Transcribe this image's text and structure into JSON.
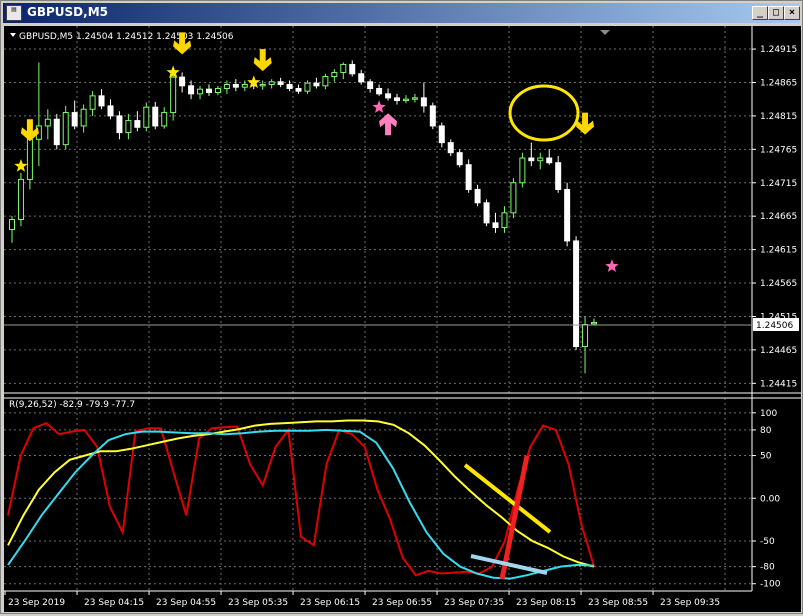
{
  "window": {
    "title": "GBPUSD,M5",
    "icon_name": "chart-window-icon",
    "buttons": {
      "minimize": "_",
      "maximize": "□",
      "close": "×"
    }
  },
  "chart_header": "GBPUSD,M5  1.24504 1.24512 1.24503 1.24506",
  "indicator_header": "R(9,26,52) -82.9 -79.9 -77.7",
  "price_labels": [
    "1.24915",
    "1.24865",
    "1.24815",
    "1.24765",
    "1.24715",
    "1.24665",
    "1.24615",
    "1.24565",
    "1.24515",
    "1.24465",
    "1.24415"
  ],
  "current_price": "1.24506",
  "indicator_labels": [
    "100",
    "80",
    "50",
    "0.00",
    "-50",
    "-80",
    "-100"
  ],
  "time_labels": [
    "23 Sep 2019",
    "23 Sep 04:15",
    "23 Sep 04:55",
    "23 Sep 05:35",
    "23 Sep 06:15",
    "23 Sep 06:55",
    "23 Sep 07:35",
    "23 Sep 08:15",
    "23 Sep 08:55",
    "23 Sep 09:35"
  ],
  "colors": {
    "background": "#000000",
    "bull_candle": "#7cfc6a",
    "bear_candle": "#ffffff",
    "grid": "#6e6e6e",
    "arrow_down": "#ffd700",
    "arrow_up": "#ff7fbf",
    "star_yellow": "#ffe600",
    "star_pink": "#ff69b4",
    "line_red": "#e00000",
    "line_yellow": "#ffff33",
    "line_cyan": "#33ddee"
  },
  "chart_data": {
    "type": "candlestick",
    "symbol": "GBPUSD",
    "timeframe": "M5",
    "ylim": [
      1.24405,
      1.24945
    ],
    "candles": [
      [
        1.24645,
        1.24665,
        1.24625,
        1.2466
      ],
      [
        1.2466,
        1.2473,
        1.2465,
        1.2472
      ],
      [
        1.2472,
        1.2479,
        1.24705,
        1.2478
      ],
      [
        1.2478,
        1.24895,
        1.2474,
        1.248
      ],
      [
        1.248,
        1.24825,
        1.2478,
        1.2481
      ],
      [
        1.2481,
        1.24818,
        1.24765,
        1.24772
      ],
      [
        1.24772,
        1.2483,
        1.24765,
        1.2482
      ],
      [
        1.2482,
        1.24838,
        1.24795,
        1.248
      ],
      [
        1.248,
        1.24832,
        1.2479,
        1.24825
      ],
      [
        1.24825,
        1.24852,
        1.24815,
        1.24845
      ],
      [
        1.24845,
        1.24855,
        1.24825,
        1.2483
      ],
      [
        1.2483,
        1.2484,
        1.2481,
        1.24815
      ],
      [
        1.24815,
        1.24822,
        1.2478,
        1.2479
      ],
      [
        1.2479,
        1.24818,
        1.2478,
        1.24808
      ],
      [
        1.24808,
        1.24822,
        1.24792,
        1.24798
      ],
      [
        1.24798,
        1.24835,
        1.24792,
        1.24828
      ],
      [
        1.24828,
        1.24836,
        1.24795,
        1.248
      ],
      [
        1.248,
        1.24828,
        1.24796,
        1.2482
      ],
      [
        1.2482,
        1.2488,
        1.24808,
        1.24873
      ],
      [
        1.24873,
        1.2488,
        1.2485,
        1.2486
      ],
      [
        1.2486,
        1.24868,
        1.2484,
        1.24848
      ],
      [
        1.24848,
        1.2486,
        1.2484,
        1.24855
      ],
      [
        1.24855,
        1.24862,
        1.24845,
        1.2485
      ],
      [
        1.2485,
        1.2486,
        1.24846,
        1.24856
      ],
      [
        1.24856,
        1.24868,
        1.24848,
        1.24862
      ],
      [
        1.24862,
        1.2487,
        1.24852,
        1.24858
      ],
      [
        1.24858,
        1.24868,
        1.24852,
        1.24862
      ],
      [
        1.24862,
        1.2487,
        1.24855,
        1.2486
      ],
      [
        1.2486,
        1.24868,
        1.24854,
        1.24862
      ],
      [
        1.24862,
        1.2487,
        1.24856,
        1.24866
      ],
      [
        1.24866,
        1.24872,
        1.24858,
        1.24862
      ],
      [
        1.24862,
        1.24868,
        1.24852,
        1.24856
      ],
      [
        1.24856,
        1.24862,
        1.24848,
        1.24852
      ],
      [
        1.24852,
        1.24868,
        1.24848,
        1.24864
      ],
      [
        1.24864,
        1.24872,
        1.24856,
        1.2486
      ],
      [
        1.2486,
        1.24878,
        1.24855,
        1.24874
      ],
      [
        1.24874,
        1.24885,
        1.24866,
        1.2488
      ],
      [
        1.2488,
        1.24895,
        1.2487,
        1.24892
      ],
      [
        1.24892,
        1.24898,
        1.24874,
        1.24878
      ],
      [
        1.24878,
        1.24884,
        1.24862,
        1.24866
      ],
      [
        1.24866,
        1.2487,
        1.2485,
        1.24856
      ],
      [
        1.24856,
        1.24862,
        1.24845,
        1.24848
      ],
      [
        1.24848,
        1.24856,
        1.24838,
        1.24842
      ],
      [
        1.24842,
        1.24848,
        1.24832,
        1.24838
      ],
      [
        1.24838,
        1.24846,
        1.24834,
        1.2484
      ],
      [
        1.2484,
        1.24848,
        1.24835,
        1.24842
      ],
      [
        1.24842,
        1.24865,
        1.2482,
        1.2483
      ],
      [
        1.2483,
        1.24835,
        1.24795,
        1.248
      ],
      [
        1.248,
        1.24805,
        1.24768,
        1.24775
      ],
      [
        1.24775,
        1.2478,
        1.24755,
        1.2476
      ],
      [
        1.2476,
        1.24765,
        1.24738,
        1.24742
      ],
      [
        1.24742,
        1.2475,
        1.247,
        1.24705
      ],
      [
        1.24705,
        1.24712,
        1.2468,
        1.24685
      ],
      [
        1.24685,
        1.2469,
        1.2465,
        1.24655
      ],
      [
        1.24655,
        1.2467,
        1.2464,
        1.24648
      ],
      [
        1.24648,
        1.2468,
        1.2464,
        1.2467
      ],
      [
        1.2467,
        1.24722,
        1.24662,
        1.24715
      ],
      [
        1.24715,
        1.2476,
        1.24708,
        1.24752
      ],
      [
        1.24752,
        1.24775,
        1.2474,
        1.24748
      ],
      [
        1.24748,
        1.2476,
        1.24735,
        1.24752
      ],
      [
        1.24752,
        1.24765,
        1.24742,
        1.24745
      ],
      [
        1.24745,
        1.24755,
        1.247,
        1.24705
      ],
      [
        1.24705,
        1.24715,
        1.2462,
        1.24628
      ],
      [
        1.24628,
        1.24635,
        1.24465,
        1.2447
      ],
      [
        1.2447,
        1.24515,
        1.2443,
        1.24503
      ],
      [
        1.24504,
        1.24512,
        1.24503,
        1.24506
      ]
    ],
    "signals": [
      {
        "type": "arrow_down",
        "bar": 2,
        "price": 1.2478
      },
      {
        "type": "star",
        "color": "yellow",
        "bar": 1,
        "price": 1.2474
      },
      {
        "type": "arrow_down",
        "bar": 19,
        "price": 1.2491
      },
      {
        "type": "star",
        "color": "yellow",
        "bar": 18,
        "price": 1.2488
      },
      {
        "type": "arrow_down",
        "bar": 28,
        "price": 1.24885
      },
      {
        "type": "star",
        "color": "yellow",
        "bar": 27,
        "price": 1.24865
      },
      {
        "type": "arrow_up",
        "bar": 42,
        "price": 1.2481
      },
      {
        "type": "star",
        "color": "pink",
        "bar": 41,
        "price": 1.24828
      },
      {
        "type": "arrow_down",
        "bar": 64,
        "price": 1.2479
      },
      {
        "type": "star",
        "color": "pink",
        "bar": 67,
        "price": 1.2459
      }
    ],
    "indicator": {
      "name": "R(9,26,52)",
      "ylim": [
        -105,
        115
      ],
      "levels": [
        100,
        80,
        50,
        0,
        -50,
        -80,
        -100
      ],
      "series": [
        {
          "color": "red",
          "values": [
            -20,
            50,
            82,
            88,
            75,
            78,
            80,
            60,
            -10,
            -40,
            78,
            82,
            82,
            30,
            -20,
            70,
            82,
            83,
            84,
            40,
            15,
            60,
            80,
            -45,
            -55,
            40,
            80,
            75,
            60,
            10,
            -25,
            -70,
            -90,
            -85,
            -88,
            -87,
            -86,
            -88,
            -80,
            -50,
            10,
            60,
            85,
            80,
            40,
            -30,
            -80
          ]
        },
        {
          "color": "yellow",
          "values": [
            -55,
            -20,
            10,
            30,
            45,
            50,
            55,
            55,
            58,
            62,
            66,
            70,
            73,
            75,
            78,
            81,
            85,
            87,
            88,
            89,
            90,
            90,
            91,
            91,
            90,
            86,
            76,
            62,
            44,
            25,
            8,
            -8,
            -22,
            -38,
            -50,
            -58,
            -68,
            -75,
            -80
          ]
        },
        {
          "color": "cyan",
          "values": [
            -78,
            -50,
            -20,
            5,
            30,
            50,
            68,
            75,
            78,
            78,
            77,
            76,
            76,
            75,
            76,
            78,
            79,
            79,
            79,
            80,
            79,
            78,
            65,
            35,
            -5,
            -40,
            -65,
            -80,
            -88,
            -93,
            -94,
            -90,
            -85,
            -80,
            -78,
            -79
          ]
        }
      ]
    },
    "annotations": [
      {
        "type": "circle",
        "color": "yellow",
        "near_bar": 64
      },
      {
        "type": "line",
        "color": "yellow",
        "pane": "indicator"
      },
      {
        "type": "line",
        "color": "red",
        "pane": "indicator"
      },
      {
        "type": "line",
        "color": "lightblue",
        "pane": "indicator"
      }
    ]
  }
}
